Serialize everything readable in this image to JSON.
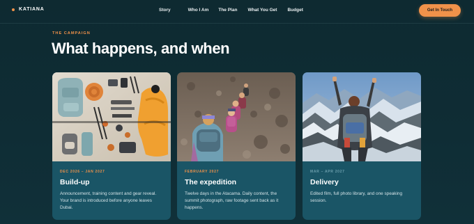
{
  "nav": {
    "brand": "KATIANA",
    "links": [
      "Story",
      "Who I Am",
      "The Plan",
      "What You Get",
      "Budget"
    ],
    "cta": "Get In Touch"
  },
  "section": {
    "eyebrow": "THE CAMPAIGN",
    "title": "What happens, and when"
  },
  "cards": [
    {
      "date": "DEC 2026 – JAN 2027",
      "title": "Build-up",
      "text": "Announcement, training content and gear reveal. Your brand is introduced before anyone leaves Dubai.",
      "image": "gear-flatlay-photo"
    },
    {
      "date": "FEBRUARY 2027",
      "title": "The expedition",
      "text": "Twelve days in the Atacama. Daily content, the summit photograph, raw footage sent back as it happens.",
      "image": "hikers-trail-photo"
    },
    {
      "date": "MAR – APR 2027",
      "title": "Delivery",
      "text": "Edited film, full photo library, and one speaking session.",
      "image": "summit-celebration-photo"
    }
  ],
  "colors": {
    "background": "#0f2a32",
    "accent": "#f0924a",
    "card": "#1a5566"
  }
}
